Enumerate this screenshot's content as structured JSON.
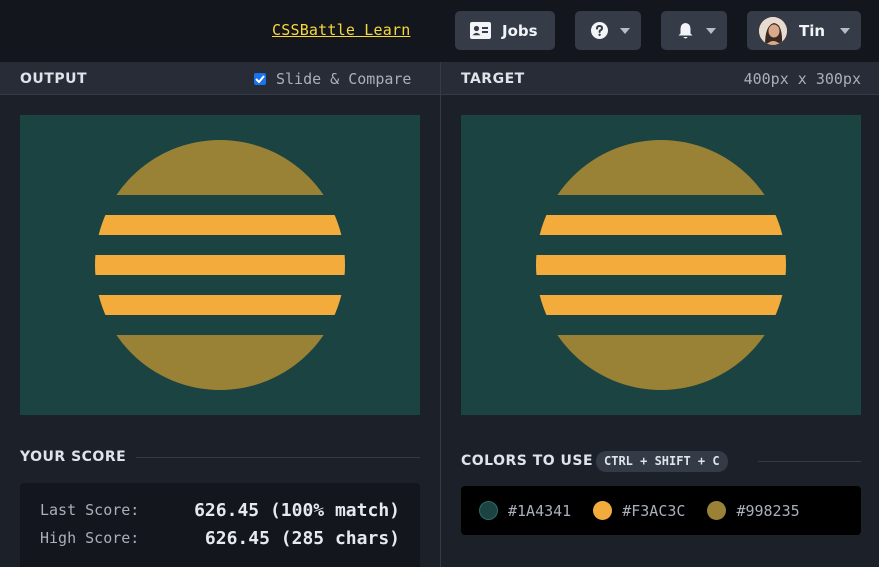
{
  "topbar": {
    "learn_link": "CSSBattle Learn",
    "jobs_label": "Jobs",
    "help_icon": "question-circle-icon",
    "bell_icon": "bell-icon",
    "user_name": "Tin"
  },
  "output": {
    "title": "OUTPUT",
    "compare_label": "Slide & Compare",
    "compare_checked": true
  },
  "target": {
    "title": "TARGET",
    "dimensions": "400px x 300px"
  },
  "score": {
    "title": "YOUR SCORE",
    "last_label": "Last Score:",
    "last_value": "626.45 (100% match)",
    "high_label": "High Score:",
    "high_value": "626.45 (285 chars)"
  },
  "colors": {
    "title": "COLORS TO USE",
    "shortcut": "CTRL + SHIFT + C",
    "swatches": [
      {
        "hex": "#1A4341",
        "color": "#1A4341"
      },
      {
        "hex": "#F3AC3C",
        "color": "#F3AC3C"
      },
      {
        "hex": "#998235",
        "color": "#998235"
      }
    ]
  }
}
